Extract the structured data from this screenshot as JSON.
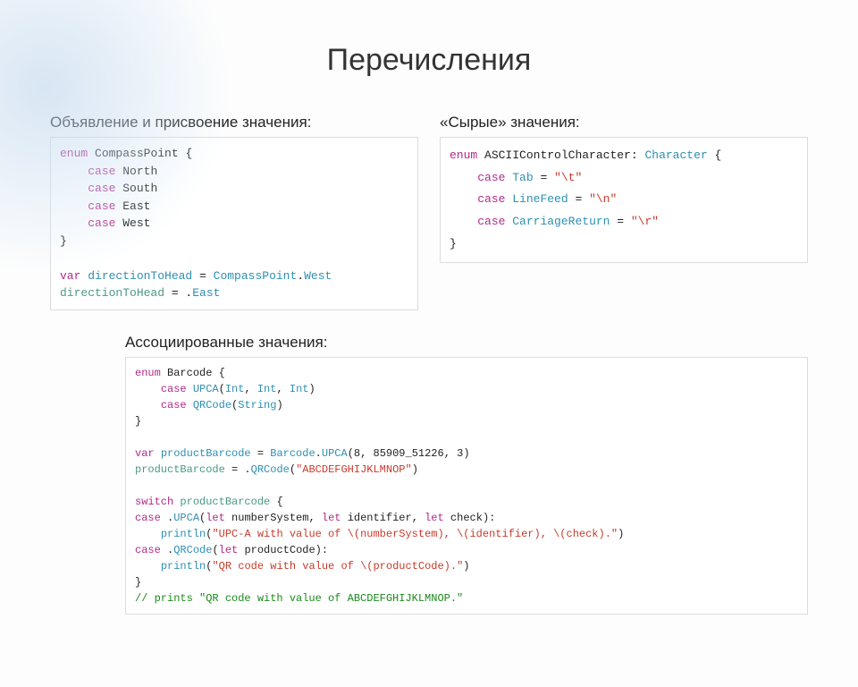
{
  "title": "Перечисления",
  "block1": {
    "label": "Объявление и присвоение значения:",
    "code": {
      "l1a": "enum",
      "l1b": "CompassPoint",
      "l2k": "case",
      "l2v": "North",
      "l3k": "case",
      "l3v": "South",
      "l4k": "case",
      "l4v": "East",
      "l5k": "case",
      "l5v": "West",
      "l7a": "var",
      "l7b": "directionToHead",
      "l7c": "CompassPoint",
      "l7d": "West",
      "l8a": "directionToHead",
      "l8b": "East"
    }
  },
  "block2": {
    "label": "«Сырые» значения:",
    "code": {
      "l1a": "enum",
      "l1b": "ASCIIControlCharacter",
      "l1c": "Character",
      "l2k": "case",
      "l2v": "Tab",
      "l2s": "\"\\t\"",
      "l3k": "case",
      "l3v": "LineFeed",
      "l3s": "\"\\n\"",
      "l4k": "case",
      "l4v": "CarriageReturn",
      "l4s": "\"\\r\""
    }
  },
  "block3": {
    "label": "Ассоциированные значения:",
    "code": {
      "l1a": "enum",
      "l1b": "Barcode",
      "l2k": "case",
      "l2v": "UPCA",
      "l2t1": "Int",
      "l2t2": "Int",
      "l2t3": "Int",
      "l3k": "case",
      "l3v": "QRCode",
      "l3t1": "String",
      "l5a": "var",
      "l5b": "productBarcode",
      "l5c": "Barcode",
      "l5d": "UPCA",
      "l5n": "8, 85909_51226, 3",
      "l6a": "productBarcode",
      "l6b": "QRCode",
      "l6s": "\"ABCDEFGHIJKLMNOP\"",
      "l8a": "switch",
      "l8b": "productBarcode",
      "l9a": "case",
      "l9b": "UPCA",
      "l9let": "let",
      "l9p1": "numberSystem",
      "l9p2": "identifier",
      "l9p3": "check",
      "l10f": "println",
      "l10s": "\"UPC-A with value of \\(numberSystem), \\(identifier), \\(check).\"",
      "l11a": "case",
      "l11b": "QRCode",
      "l11let": "let",
      "l11p": "productCode",
      "l12f": "println",
      "l12s": "\"QR code with value of \\(productCode).\"",
      "l14": "// prints \"QR code with value of ABCDEFGHIJKLMNOP.\""
    }
  }
}
